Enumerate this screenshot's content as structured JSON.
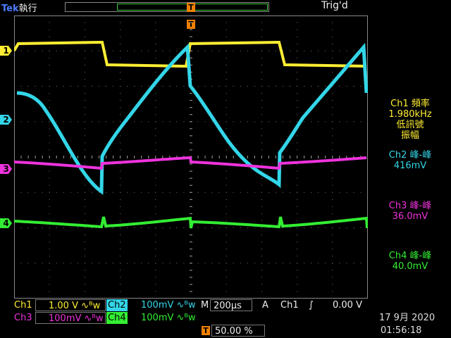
{
  "header": {
    "brand": "Tek",
    "run_state": "執行",
    "trigger_status": "Trig'd",
    "trigger_marker": "T"
  },
  "channels": [
    {
      "id": "1",
      "color": "#ffee33"
    },
    {
      "id": "2",
      "color": "#33d6e8"
    },
    {
      "id": "3",
      "color": "#ee33dd"
    },
    {
      "id": "4",
      "color": "#33ee33"
    }
  ],
  "measurements": {
    "m1_label": "Ch1 頻率",
    "m1_value": "1.980kHz",
    "m1_note1": "低訊號",
    "m1_note2": "振幅",
    "m2_label": "Ch2 峰-峰",
    "m2_value": "416mV",
    "m3_label": "Ch3 峰-峰",
    "m3_value": "36.0mV",
    "m4_label": "Ch4 峰-峰",
    "m4_value": "40.0mV"
  },
  "status": {
    "ch1_name": "Ch1",
    "ch1_scale": "1.00 V",
    "ch2_name": "Ch2",
    "ch2_scale": "100mV",
    "ch3_name": "Ch3",
    "ch3_scale": "100mV",
    "ch4_name": "Ch4",
    "ch4_scale": "100mV",
    "bw_symbol": "∿ᴮw",
    "timebase_prefix": "M",
    "timebase": "200µs",
    "trigger_coupling": "A",
    "trigger_source": "Ch1",
    "trigger_slope": "∫",
    "trigger_level": "0.00 V",
    "trigger_pos_marker": "T",
    "trigger_position": "50.00 %",
    "date": "17 9月  2020",
    "time": "01:56:18"
  },
  "colors": {
    "ch1": "#ffee33",
    "ch2": "#33d6e8",
    "ch3": "#ee33dd",
    "ch4": "#33ee33",
    "grid": "#777777",
    "trigger": "#f08000"
  }
}
